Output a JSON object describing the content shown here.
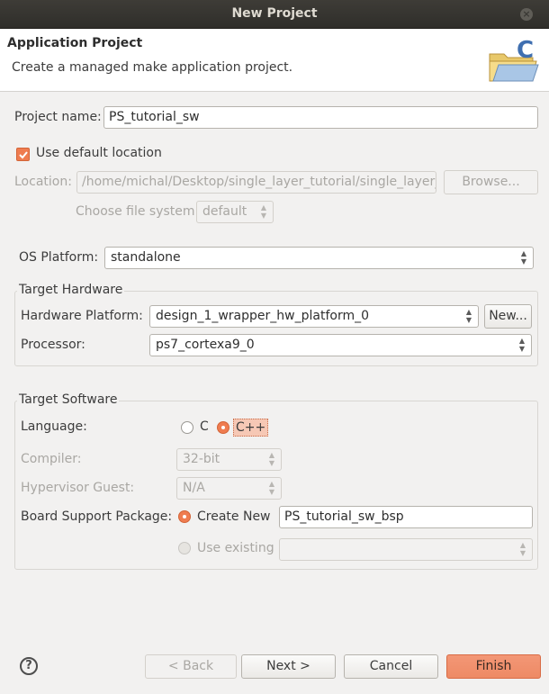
{
  "window": {
    "title": "New Project",
    "close_icon": "close-icon"
  },
  "header": {
    "title": "Application Project",
    "description": "Create a managed make application project."
  },
  "project": {
    "name_label": "Project name:",
    "name_value": "PS_tutorial_sw",
    "use_default_label": "Use default location",
    "use_default_checked": true,
    "location_label": "Location:",
    "location_value": "/home/michal/Desktop/single_layer_tutorial/single_layer_t",
    "browse_label": "Browse...",
    "filesystem_label": "Choose file system:",
    "filesystem_value": "default"
  },
  "os": {
    "label": "OS Platform:",
    "value": "standalone"
  },
  "target_hardware": {
    "group_title": "Target Hardware",
    "platform_label": "Hardware Platform:",
    "platform_value": "design_1_wrapper_hw_platform_0",
    "new_label": "New...",
    "processor_label": "Processor:",
    "processor_value": "ps7_cortexa9_0"
  },
  "target_software": {
    "group_title": "Target Software",
    "language_label": "Language:",
    "lang_c": "C",
    "lang_cpp": "C++",
    "selected_language": "C++",
    "compiler_label": "Compiler:",
    "compiler_value": "32-bit",
    "hypervisor_label": "Hypervisor Guest:",
    "hypervisor_value": "N/A",
    "bsp_label": "Board Support Package:",
    "create_new_label": "Create New",
    "bsp_name_value": "PS_tutorial_sw_bsp",
    "use_existing_label": "Use existing",
    "use_existing_value": ""
  },
  "footer": {
    "help": "?",
    "back": "< Back",
    "next": "Next >",
    "cancel": "Cancel",
    "finish": "Finish"
  },
  "colors": {
    "accent": "#ef7c50",
    "titlebar": "#3a3935",
    "finish_button": "#f0906d"
  }
}
